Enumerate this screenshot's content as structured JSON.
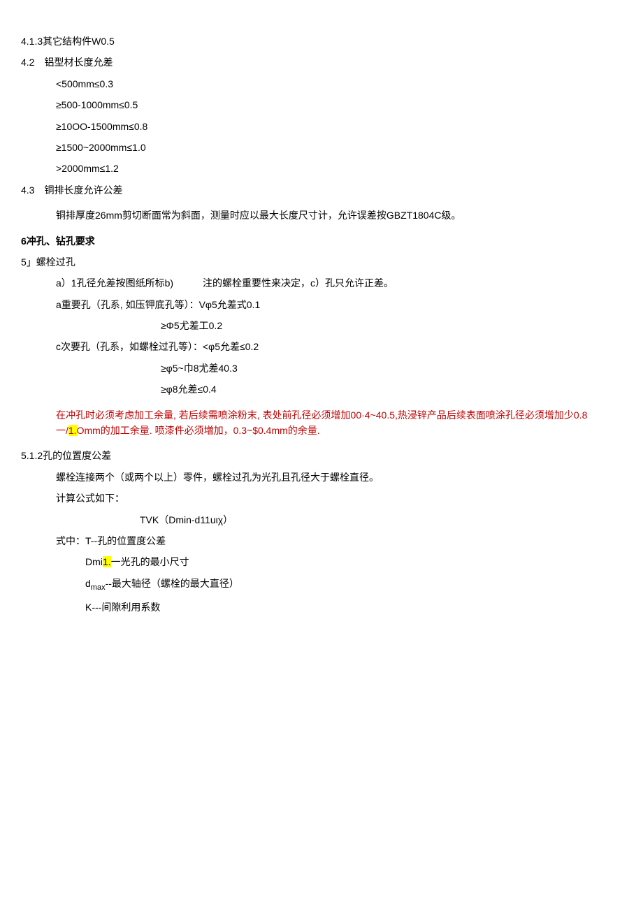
{
  "s413": "4.1.3其它结构件W0.5",
  "s42_header": "4.2　铝型材长度允差",
  "s42_items": [
    "<500mm≤0.3",
    "≥500-1000mm≤0.5",
    "≥10OO-1500mm≤0.8",
    "≥1500~2000mm≤1.0",
    ">2000mm≤1.2"
  ],
  "s43_header": "4.3　铜排长度允许公差",
  "s43_body": "铜排厚度26mm剪切断面常为斜面，测量时应以最大长度尺寸计，允许误差按GBZT1804C级。",
  "s6_header": "6冲孔、钻孔要求",
  "s51_header": "5」螺栓过孔",
  "s51_a": "a）1孔径允差按图纸所标b)　　　注的螺栓重要性来决定，c）孔只允许正差。",
  "s51_a_important": "a重要孔（孔系, 如压钾底孔等）：Vφ5允差式0.1",
  "s51_a_important2": "≥Φ5尤差工0.2",
  "s51_c_minor": "c次要孔（孔系，如螺栓过孔等）：<φ5允差≤0.2",
  "s51_c_minor2": "≥φ5~巾8尤差40.3",
  "s51_c_minor3": "≥φ8允差≤0.4",
  "s51_red1_pre": "在冲孔时必须考虑加工余量, 若后续需喷涂粉末, 表处前孔径必须增加00·4~40.5,热浸锌产品后续表面喷涂孔径必须增加少0.8一/",
  "s51_red1_hl": "1.",
  "s51_red1_post": "Omm的加工余量. 喷漆件必须増加，0.3~$0.4mm的余量.",
  "s512_header": "5.1.2孔的位置度公差",
  "s512_l1": "螺栓连接两个（或两个以上）零件，螺栓过孔为光孔且孔径大于螺栓直径。",
  "s512_l2": "计算公式如下：",
  "s512_formula": "TVK（Dmin-d11uιχ）",
  "s512_where": "式中：T--孔的位置度公差",
  "s512_dmi_pre": "Dmi",
  "s512_dmi_hl": "1.",
  "s512_dmi_post": "一光孔的最小尺寸",
  "s512_dmax_pre": "d",
  "s512_dmax_sub": "max",
  "s512_dmax_post": "--最大轴径（螺栓的最大直径）",
  "s512_k": "K---间隙利用系数"
}
